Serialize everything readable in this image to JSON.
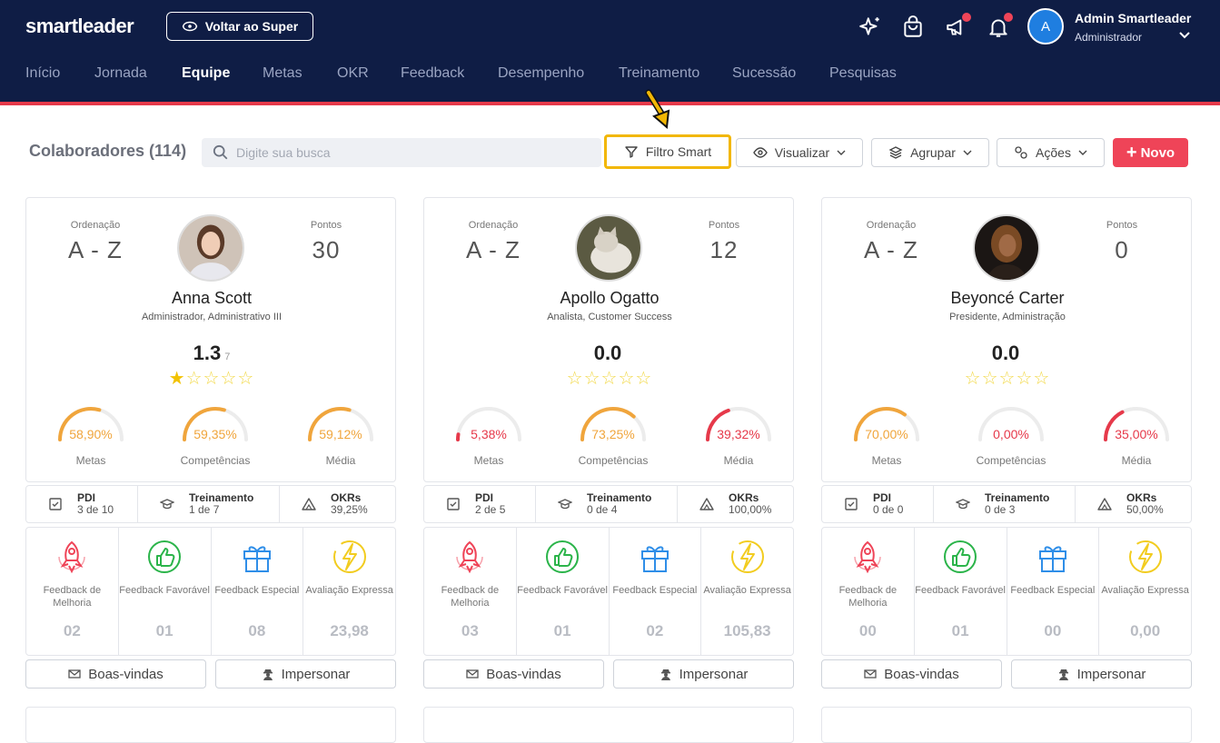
{
  "header": {
    "logo": "smartleader",
    "back_button": "Voltar ao Super",
    "user": {
      "avatar_letter": "A",
      "name": "Admin Smartleader",
      "role": "Administrador"
    },
    "colors": {
      "bg": "#0f1d45",
      "accent": "#ef4458"
    }
  },
  "nav": [
    {
      "label": "Início",
      "active": false
    },
    {
      "label": "Jornada",
      "active": false
    },
    {
      "label": "Equipe",
      "active": true
    },
    {
      "label": "Metas",
      "active": false
    },
    {
      "label": "OKR",
      "active": false
    },
    {
      "label": "Feedback",
      "active": false
    },
    {
      "label": "Desempenho",
      "active": false
    },
    {
      "label": "Treinamento",
      "active": false
    },
    {
      "label": "Sucessão",
      "active": false
    },
    {
      "label": "Pesquisas",
      "active": false
    }
  ],
  "toolbar": {
    "title": "Colaboradores (114)",
    "search_placeholder": "Digite sua busca",
    "filter": "Filtro Smart",
    "view": "Visualizar",
    "group": "Agrupar",
    "actions": "Ações",
    "new": "Novo"
  },
  "labels": {
    "ordering": "Ordenação",
    "points": "Pontos",
    "pdi": "PDI",
    "training": "Treinamento",
    "okrs": "OKRs",
    "fb_improve": "Feedback de Melhoria",
    "fb_favorable": "Feedback Favorável",
    "fb_special": "Feedback Especial",
    "fb_express": "Avaliação Expressa",
    "welcome": "Boas-vindas",
    "impersonate": "Impersonar",
    "metas": "Metas",
    "competencias": "Competências",
    "media": "Média"
  },
  "cards": [
    {
      "ordering": "A - Z",
      "points": "30",
      "name": "Anna Scott",
      "role": "Administrador, Administrativo III",
      "score": "1.3",
      "score_sub": "7",
      "stars_filled": 1,
      "gauges": [
        {
          "value": "58,90%",
          "pct": 58.9,
          "color": "#f0a53c"
        },
        {
          "value": "59,35%",
          "pct": 59.35,
          "color": "#f0a53c"
        },
        {
          "value": "59,12%",
          "pct": 59.12,
          "color": "#f0a53c"
        }
      ],
      "pdi": "3 de 10",
      "training": "1 de 7",
      "okrs": "39,25%",
      "fb": [
        "02",
        "01",
        "08",
        "23,98"
      ]
    },
    {
      "ordering": "A - Z",
      "points": "12",
      "name": "Apollo Ogatto",
      "role": "Analista, Customer Success",
      "score": "0.0",
      "score_sub": "",
      "stars_filled": 0,
      "gauges": [
        {
          "value": "5,38%",
          "pct": 5.38,
          "color": "#e6394a"
        },
        {
          "value": "73,25%",
          "pct": 73.25,
          "color": "#f0a53c"
        },
        {
          "value": "39,32%",
          "pct": 39.32,
          "color": "#e6394a"
        }
      ],
      "pdi": "2 de 5",
      "training": "0 de 4",
      "okrs": "100,00%",
      "fb": [
        "03",
        "01",
        "02",
        "105,83"
      ]
    },
    {
      "ordering": "A - Z",
      "points": "0",
      "name": "Beyoncé Carter",
      "role": "Presidente, Administração",
      "score": "0.0",
      "score_sub": "",
      "stars_filled": 0,
      "gauges": [
        {
          "value": "70,00%",
          "pct": 70.0,
          "color": "#f0a53c"
        },
        {
          "value": "0,00%",
          "pct": 0,
          "color": "#e6394a"
        },
        {
          "value": "35,00%",
          "pct": 35.0,
          "color": "#e6394a"
        }
      ],
      "pdi": "0 de 0",
      "training": "0 de 3",
      "okrs": "50,00%",
      "fb": [
        "00",
        "01",
        "00",
        "0,00"
      ]
    }
  ]
}
